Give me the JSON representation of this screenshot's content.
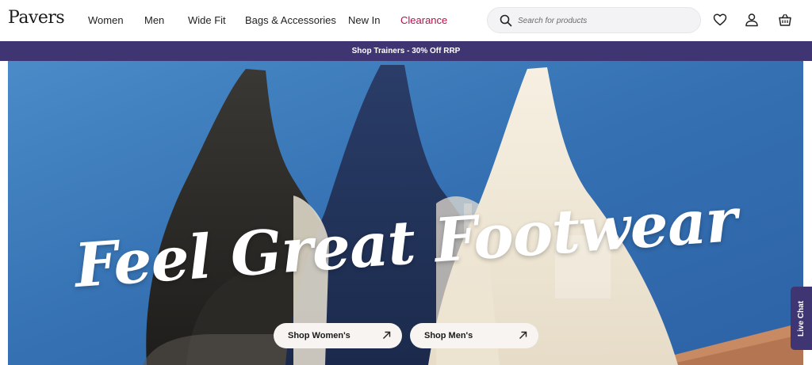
{
  "brand": {
    "logo_text": "Pavers"
  },
  "nav": {
    "items": [
      {
        "label": "Women"
      },
      {
        "label": "Men"
      },
      {
        "label": "Wide Fit"
      },
      {
        "label": "Bags & Accessories"
      },
      {
        "label": "New In"
      },
      {
        "label": "Clearance",
        "color": "#b0124a"
      }
    ]
  },
  "search": {
    "placeholder": "Search for products"
  },
  "header_icons": [
    "heart-icon",
    "user-icon",
    "bag-icon"
  ],
  "promo": {
    "text": "Shop Trainers - 30% Off RRP",
    "bg": "#3f3572"
  },
  "hero": {
    "headline": "Feel Great Footwear",
    "buttons": [
      {
        "label": "Shop Women's",
        "icon": "arrow-up-right-icon"
      },
      {
        "label": "Shop Men's",
        "icon": "arrow-up-right-icon"
      }
    ]
  },
  "live_chat": {
    "label": "Live Chat"
  },
  "colors": {
    "accent": "#3f3572",
    "clearance": "#b0124a",
    "hero_wall": "#3b78b8"
  }
}
